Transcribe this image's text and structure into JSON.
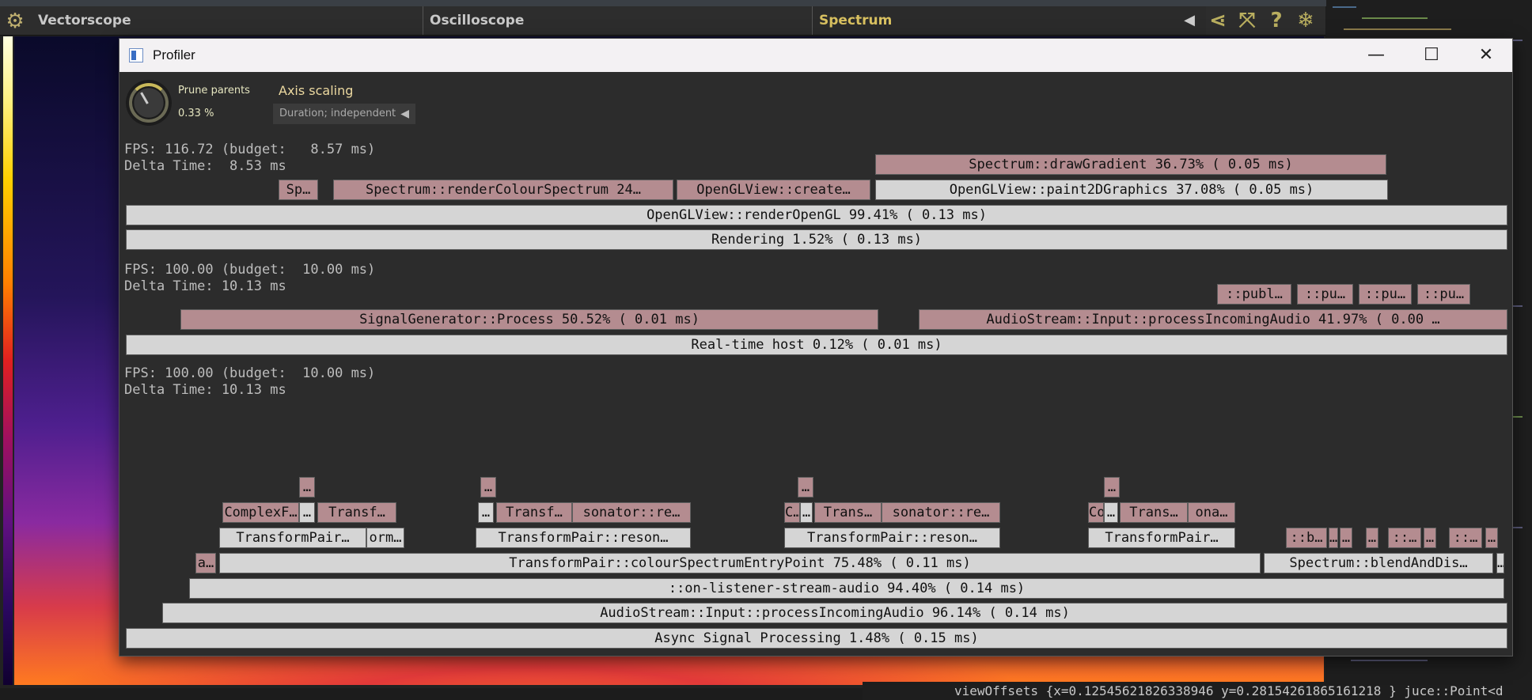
{
  "app": {
    "tabs": [
      "Vectorscope",
      "Oscilloscope",
      "Spectrum"
    ],
    "active_tab": "Spectrum",
    "toolbar_icons": [
      "back-arrow-icon",
      "share-icon",
      "fullscreen-icon",
      "help-icon",
      "snowflake-icon"
    ]
  },
  "window": {
    "title": "Profiler",
    "buttons": {
      "minimize": "—",
      "maximize": "☐",
      "close": "✕"
    }
  },
  "controls": {
    "prune_label": "Prune parents",
    "prune_value": "0.33 %",
    "axis_label": "Axis scaling",
    "axis_value": "Duration; independent"
  },
  "groups": [
    {
      "fps_line": "FPS: 116.72 (budget:   8.57 ms)",
      "delta_line": "Delta Time:  8.53 ms",
      "blocks": {
        "b0": "Spectrum::drawGradient 36.73%  ( 0.05 ms)",
        "b1": "Sp…",
        "b2": "Spectrum::renderColourSpectrum 24…",
        "b3": "OpenGLView::create…",
        "b4": "OpenGLView::paint2DGraphics 37.08%  ( 0.05 ms)",
        "b5": "OpenGLView::renderOpenGL 99.41%  ( 0.13 ms)",
        "b6": "Rendering  1.52%  ( 0.13 ms)"
      }
    },
    {
      "fps_line": "FPS: 100.00 (budget:  10.00 ms)",
      "delta_line": "Delta Time: 10.13 ms",
      "blocks": {
        "b0": "::publ…",
        "b1": "::pu…",
        "b2": "::pu…",
        "b3": "::pu…",
        "b4": "SignalGenerator::Process 50.52%  ( 0.01 ms)",
        "b5": "AudioStream::Input::processIncomingAudio 41.97%  ( 0.00 …",
        "b6": "Real-time host  0.12%  ( 0.01 ms)"
      }
    },
    {
      "fps_line": "FPS: 100.00 (budget:  10.00 ms)",
      "delta_line": "Delta Time: 10.13 ms",
      "blocks": {
        "b0": "…",
        "b1": "…",
        "b2": "…",
        "b3": "…",
        "b4": "ComplexF…",
        "b5": "…",
        "b6": "Transf…",
        "b7": "…",
        "b8": "Transf…",
        "b9": "sonator::re…",
        "b10": "C…",
        "b11": "…",
        "b12": "Trans…",
        "b13": "sonator::re…",
        "b14": "Co…",
        "b15": "…",
        "b16": "Trans…",
        "b17": "ona…",
        "b18": "TransformPair…",
        "b19": "orm…",
        "b20": "TransformPair::reson…",
        "b21": "TransformPair::reson…",
        "b22": "TransformPair…",
        "b23": "::b…",
        "b24": "…",
        "b25": "…",
        "b26": "…",
        "b27": "::…",
        "b28": "…",
        "b29": "::…",
        "b30": "…",
        "b31": "a…",
        "b32": "TransformPair::colourSpectrumEntryPoint 75.48%  ( 0.11 ms)",
        "b33": "Spectrum::blendAndDis…",
        "b34": "…",
        "b35": "::on-listener-stream-audio 94.40%  ( 0.14 ms)",
        "b36": "AudioStream::Input::processIncomingAudio 96.14%  ( 0.14 ms)",
        "b37": "Async Signal Processing  1.48%  ( 0.15 ms)"
      }
    }
  ],
  "debug": {
    "plus": "+",
    "text": "viewOffsets {x=0.12545621826338946 y=0.28154261865161218 }  juce::Point<d"
  }
}
